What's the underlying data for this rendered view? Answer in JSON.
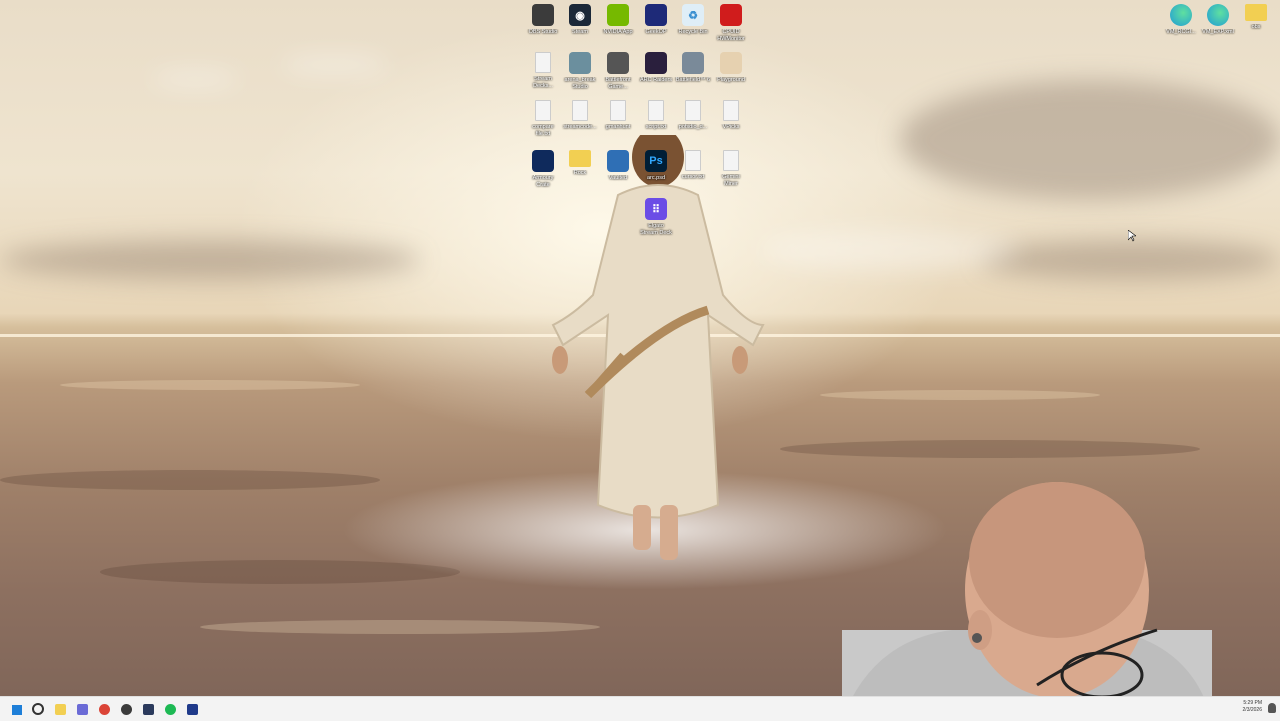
{
  "desktop_icons": [
    {
      "label": "OBS Studio",
      "icon": "obs-icon",
      "color": "#3b3b3b"
    },
    {
      "label": "Steam",
      "icon": "steam-icon",
      "color": "#1b2838"
    },
    {
      "label": "NVIDIA App",
      "icon": "nvidia-icon",
      "color": "#76b900"
    },
    {
      "label": "GeekOP",
      "icon": "app-icon",
      "color": "#1e2a78"
    },
    {
      "label": "Recycle Bin",
      "icon": "recycle-bin-icon",
      "color": "#dfeef7"
    },
    {
      "label": "CPUID\nHWMonitor",
      "icon": "hwmonitor-icon",
      "color": "#d01c1c"
    },
    {
      "label": "Stream\nDecks...",
      "icon": "file-icon",
      "color": "#f4f4f4"
    },
    {
      "label": "arena_break\nStudio",
      "icon": "app-icon",
      "color": "#6b8f9e"
    },
    {
      "label": "Battlefront\nGame...",
      "icon": "game-icon",
      "color": "#555555"
    },
    {
      "label": "ARC Raiders",
      "icon": "arc-raiders-icon",
      "color": "#2a1f3d"
    },
    {
      "label": "Battlefield™ 6",
      "icon": "battlefield-icon",
      "color": "#7a8a99"
    },
    {
      "label": "Playground",
      "icon": "playground-icon",
      "color": "#e6d1b0"
    },
    {
      "label": "compare\nfile.txt",
      "icon": "file-icon",
      "color": "#f4f4f4"
    },
    {
      "label": "streamcode...",
      "icon": "file-icon",
      "color": "#f4f4f4"
    },
    {
      "label": "gmanhunt",
      "icon": "file-icon",
      "color": "#f4f4f4"
    },
    {
      "label": "script.txt",
      "icon": "file-icon",
      "color": "#f4f4f4"
    },
    {
      "label": "pofsdio_d...",
      "icon": "file-icon",
      "color": "#f4f4f4"
    },
    {
      "label": "VPicks",
      "icon": "file-icon",
      "color": "#f4f4f4"
    },
    {
      "label": "Armoury\nCrate",
      "icon": "armoury-crate-icon",
      "color": "#0f2a5c"
    },
    {
      "label": "Rock",
      "icon": "folder-icon",
      "color": "#f2cf52"
    },
    {
      "label": "Vaulted",
      "icon": "app-icon",
      "color": "#2f6fb5"
    },
    {
      "label": "arc.psd",
      "icon": "photoshop-icon",
      "color": "#001e36"
    },
    {
      "label": "cursor.txt",
      "icon": "file-icon",
      "color": "#f4f4f4"
    },
    {
      "label": "Gemini\nMiner",
      "icon": "file-icon",
      "color": "#f4f4f4"
    },
    {
      "label": "Elgato\nStream Deck",
      "icon": "stream-deck-icon",
      "color": "#6b4de6"
    }
  ],
  "right_icons": [
    {
      "label": "VM_RCGI...",
      "icon": "edge-icon",
      "color": "#1f9bd7"
    },
    {
      "label": "VM_EXP.xml",
      "icon": "edge-icon",
      "color": "#1f9bd7"
    },
    {
      "label": "obs",
      "icon": "folder-icon",
      "color": "#f2cf52"
    }
  ],
  "taskbar": {
    "apps": [
      {
        "icon": "windows-start-icon",
        "color": "#1e7fd8"
      },
      {
        "icon": "search-icon",
        "color": "#333333"
      },
      {
        "icon": "file-explorer-icon",
        "color": "#f2cf52"
      },
      {
        "icon": "app-icon",
        "color": "#6b6bd6"
      },
      {
        "icon": "chrome-icon",
        "color": "#db4437"
      },
      {
        "icon": "obs-icon",
        "color": "#3b3b3b"
      },
      {
        "icon": "app-icon",
        "color": "#2b3a5c"
      },
      {
        "icon": "spotify-icon",
        "color": "#1db954"
      },
      {
        "icon": "vscode-icon",
        "color": "#1f3a8a"
      }
    ],
    "clock_time": "5:29 PM",
    "clock_date": "2/3/2026",
    "tray_text": "ENG"
  }
}
